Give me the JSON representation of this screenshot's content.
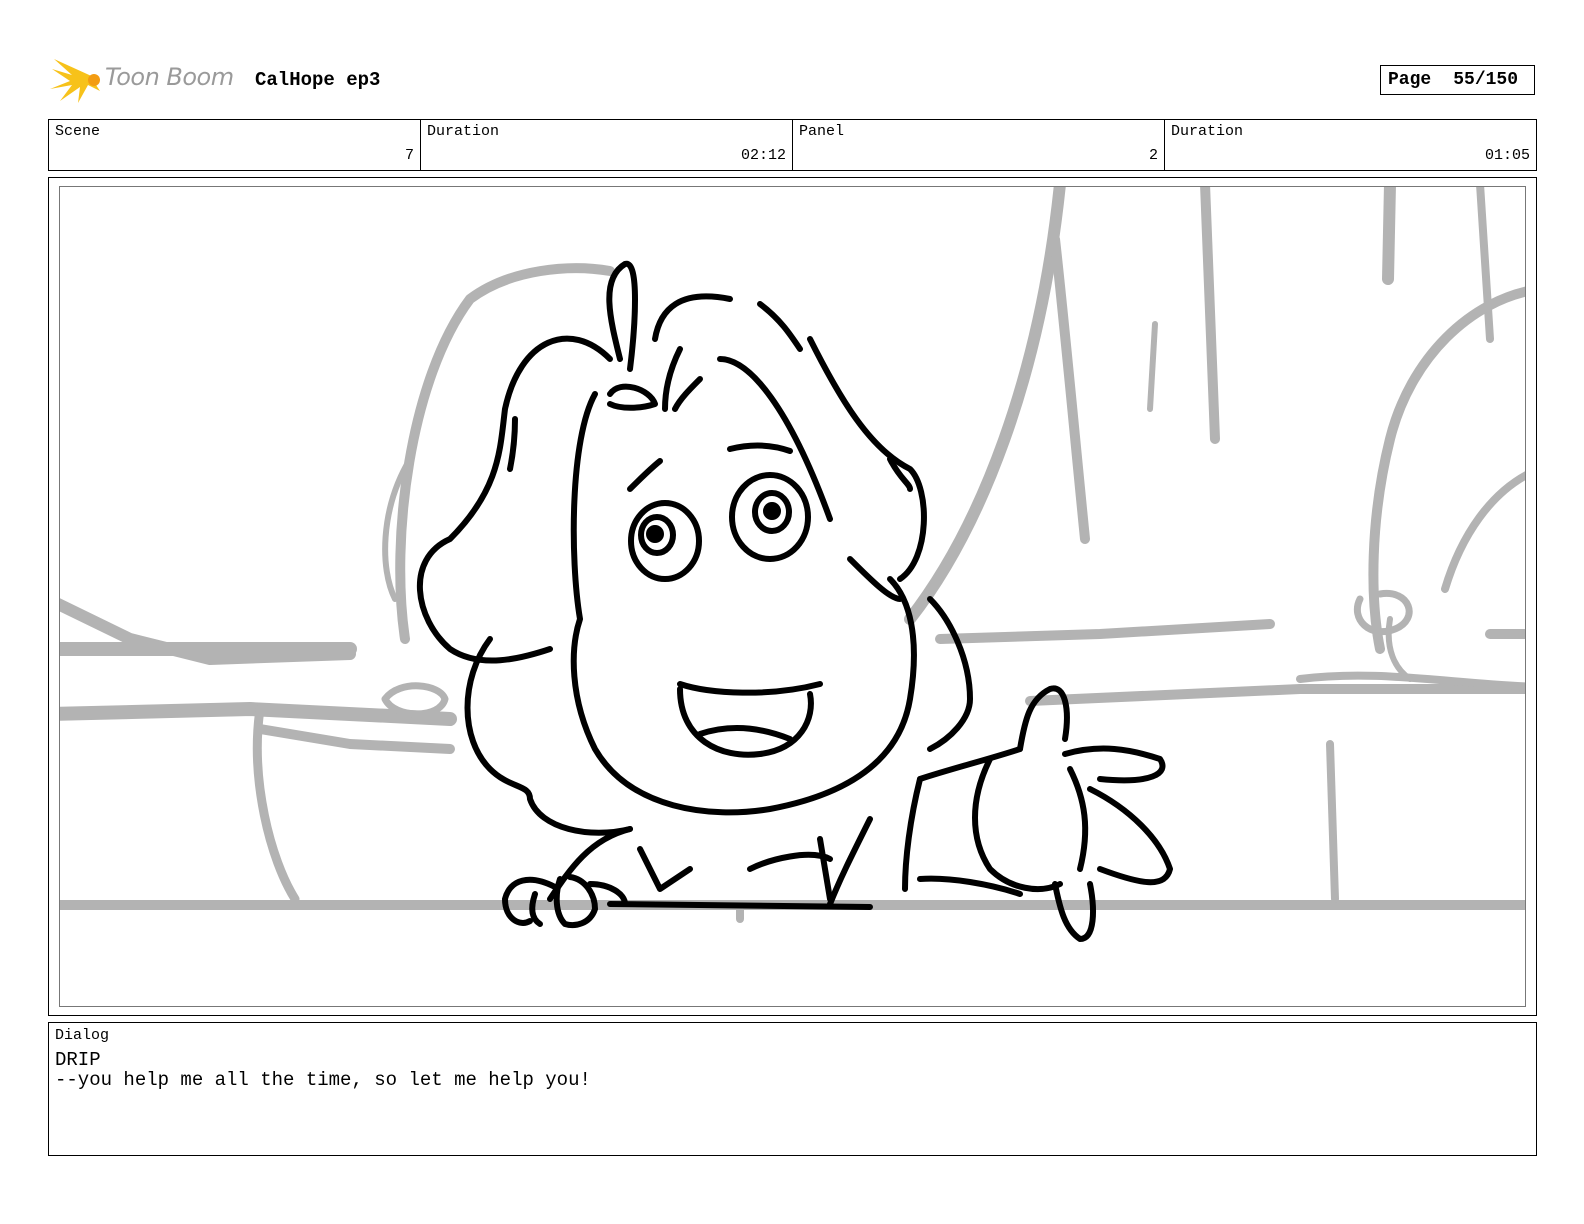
{
  "header": {
    "brand": "Toon Boom",
    "project_title": "CalHope ep3",
    "page_label": "Page",
    "page_number": "55/150"
  },
  "info": [
    {
      "label": "Scene",
      "value": "7"
    },
    {
      "label": "Duration",
      "value": "02:12"
    },
    {
      "label": "Panel",
      "value": "2"
    },
    {
      "label": "Duration",
      "value": "01:05"
    }
  ],
  "dialog": {
    "label": "Dialog",
    "speaker": "DRIP",
    "line": "--you help me all the time, so let me help you!"
  },
  "colors": {
    "logo_yellow": "#f7c21a",
    "logo_text": "#9a9a9a",
    "sketch_gray": "#b3b3b3",
    "ink": "#000000"
  }
}
